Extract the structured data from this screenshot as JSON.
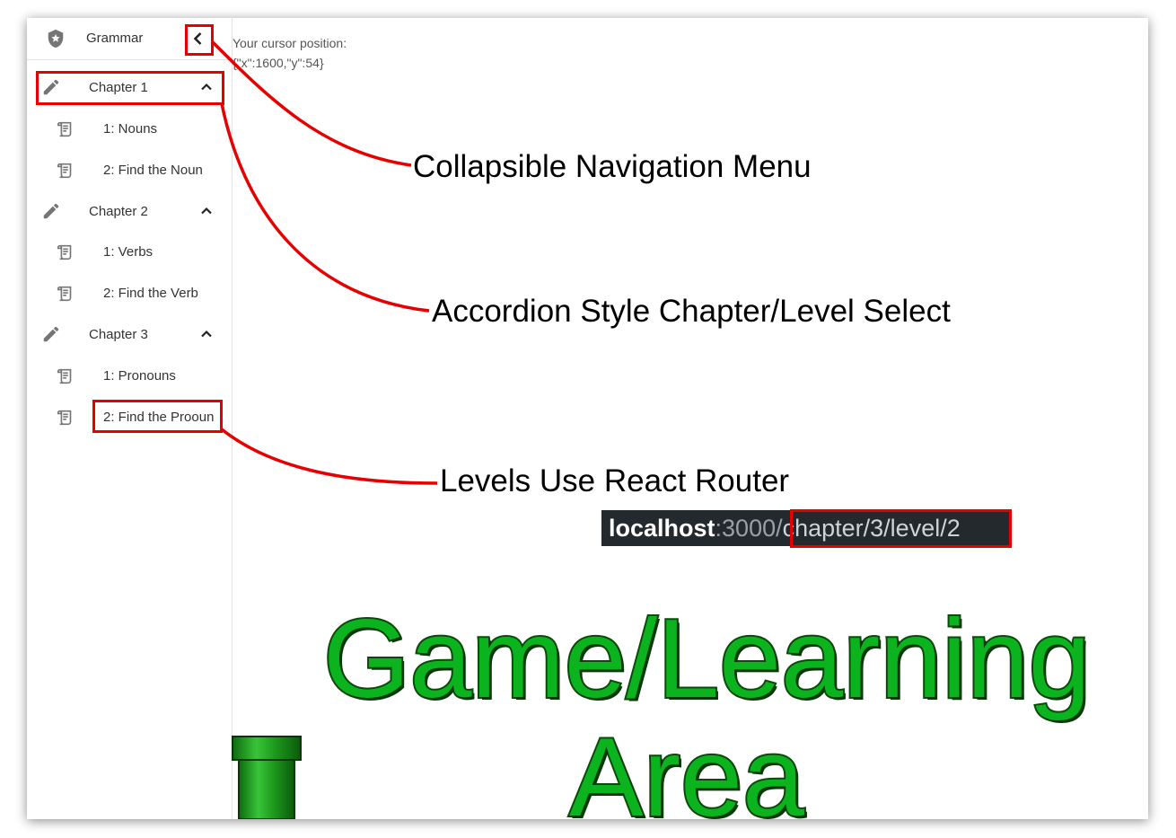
{
  "sidebar": {
    "app_title": "Grammar",
    "chapters": [
      {
        "label": "Chapter 1",
        "levels": [
          "1: Nouns",
          "2: Find the Noun"
        ]
      },
      {
        "label": "Chapter 2",
        "levels": [
          "1: Verbs",
          "2: Find the Verb"
        ]
      },
      {
        "label": "Chapter 3",
        "levels": [
          "1: Pronouns",
          "2: Find the Prooun"
        ]
      }
    ]
  },
  "main": {
    "cursor_label": "Your cursor position:",
    "cursor_value": "{\"x\":1600,\"y\":54}"
  },
  "annotations": {
    "collapsible_nav": "Collapsible Navigation Menu",
    "accordion": "Accordion Style Chapter/Level Select",
    "router": "Levels Use React Router",
    "game_area_line1": "Game/Learning",
    "game_area_line2": "Area"
  },
  "url": {
    "host": "localhost",
    "port": ":3000/",
    "path": "chapter/3/level/2"
  },
  "icons": {
    "app": "shield-star-icon",
    "chapter": "pencil-icon",
    "level": "scroll-icon",
    "collapse": "chevron-left-icon",
    "expand": "chevron-up-icon"
  },
  "colors": {
    "highlight": "#e60000",
    "title_green": "#0bb41f",
    "pipe_green": "#1f9d1f",
    "url_bg": "#24292e"
  }
}
